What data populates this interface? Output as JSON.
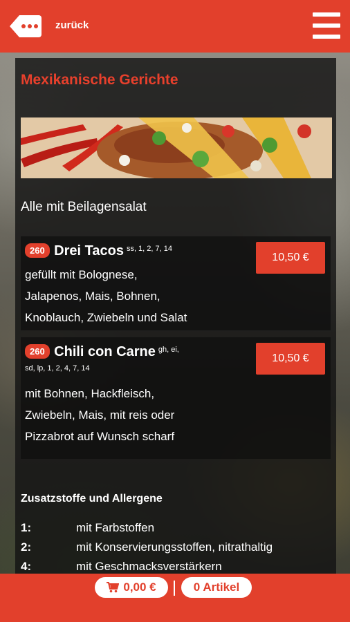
{
  "header": {
    "back_label": "zurück",
    "back_icon": "dots-back-icon",
    "menu_icon": "hamburger-icon",
    "accent_color": "#e2402c"
  },
  "category": {
    "title": "Mexikanische Gerichte",
    "note": "Alle mit Beilagensalat"
  },
  "dishes": [
    {
      "number": "260",
      "name": "Drei Tacos",
      "allergens": "ss, 1, 2, 7, 14",
      "description_lines": [
        "gefüllt mit Bolognese,",
        "Jalapenos, Mais, Bohnen,",
        "Knoblauch, Zwiebeln und Salat"
      ],
      "price": "10,50 €"
    },
    {
      "number": "260",
      "name": "Chili con Carne",
      "allergens_1": "gh, ei,",
      "allergens_2": "sd, lp, 1, 2, 4, 7, 14",
      "description_lines": [
        "mit Bohnen, Hackfleisch,",
        "Zwiebeln, Mais, mit reis oder",
        "Pizzabrot auf Wunsch scharf"
      ],
      "price": "10,50 €"
    }
  ],
  "additives": {
    "title": "Zusatzstoffe und Allergene",
    "items": [
      {
        "num": "1:",
        "text": "mit Farbstoffen"
      },
      {
        "num": "2:",
        "text": "mit Konservierungsstoffen, nitrathaltig"
      },
      {
        "num": "4:",
        "text": "mit Geschmacksverstärkern"
      }
    ]
  },
  "cart": {
    "total": "0,00 €",
    "count": "0 Artikel",
    "cart_icon": "shopping-cart-icon"
  }
}
